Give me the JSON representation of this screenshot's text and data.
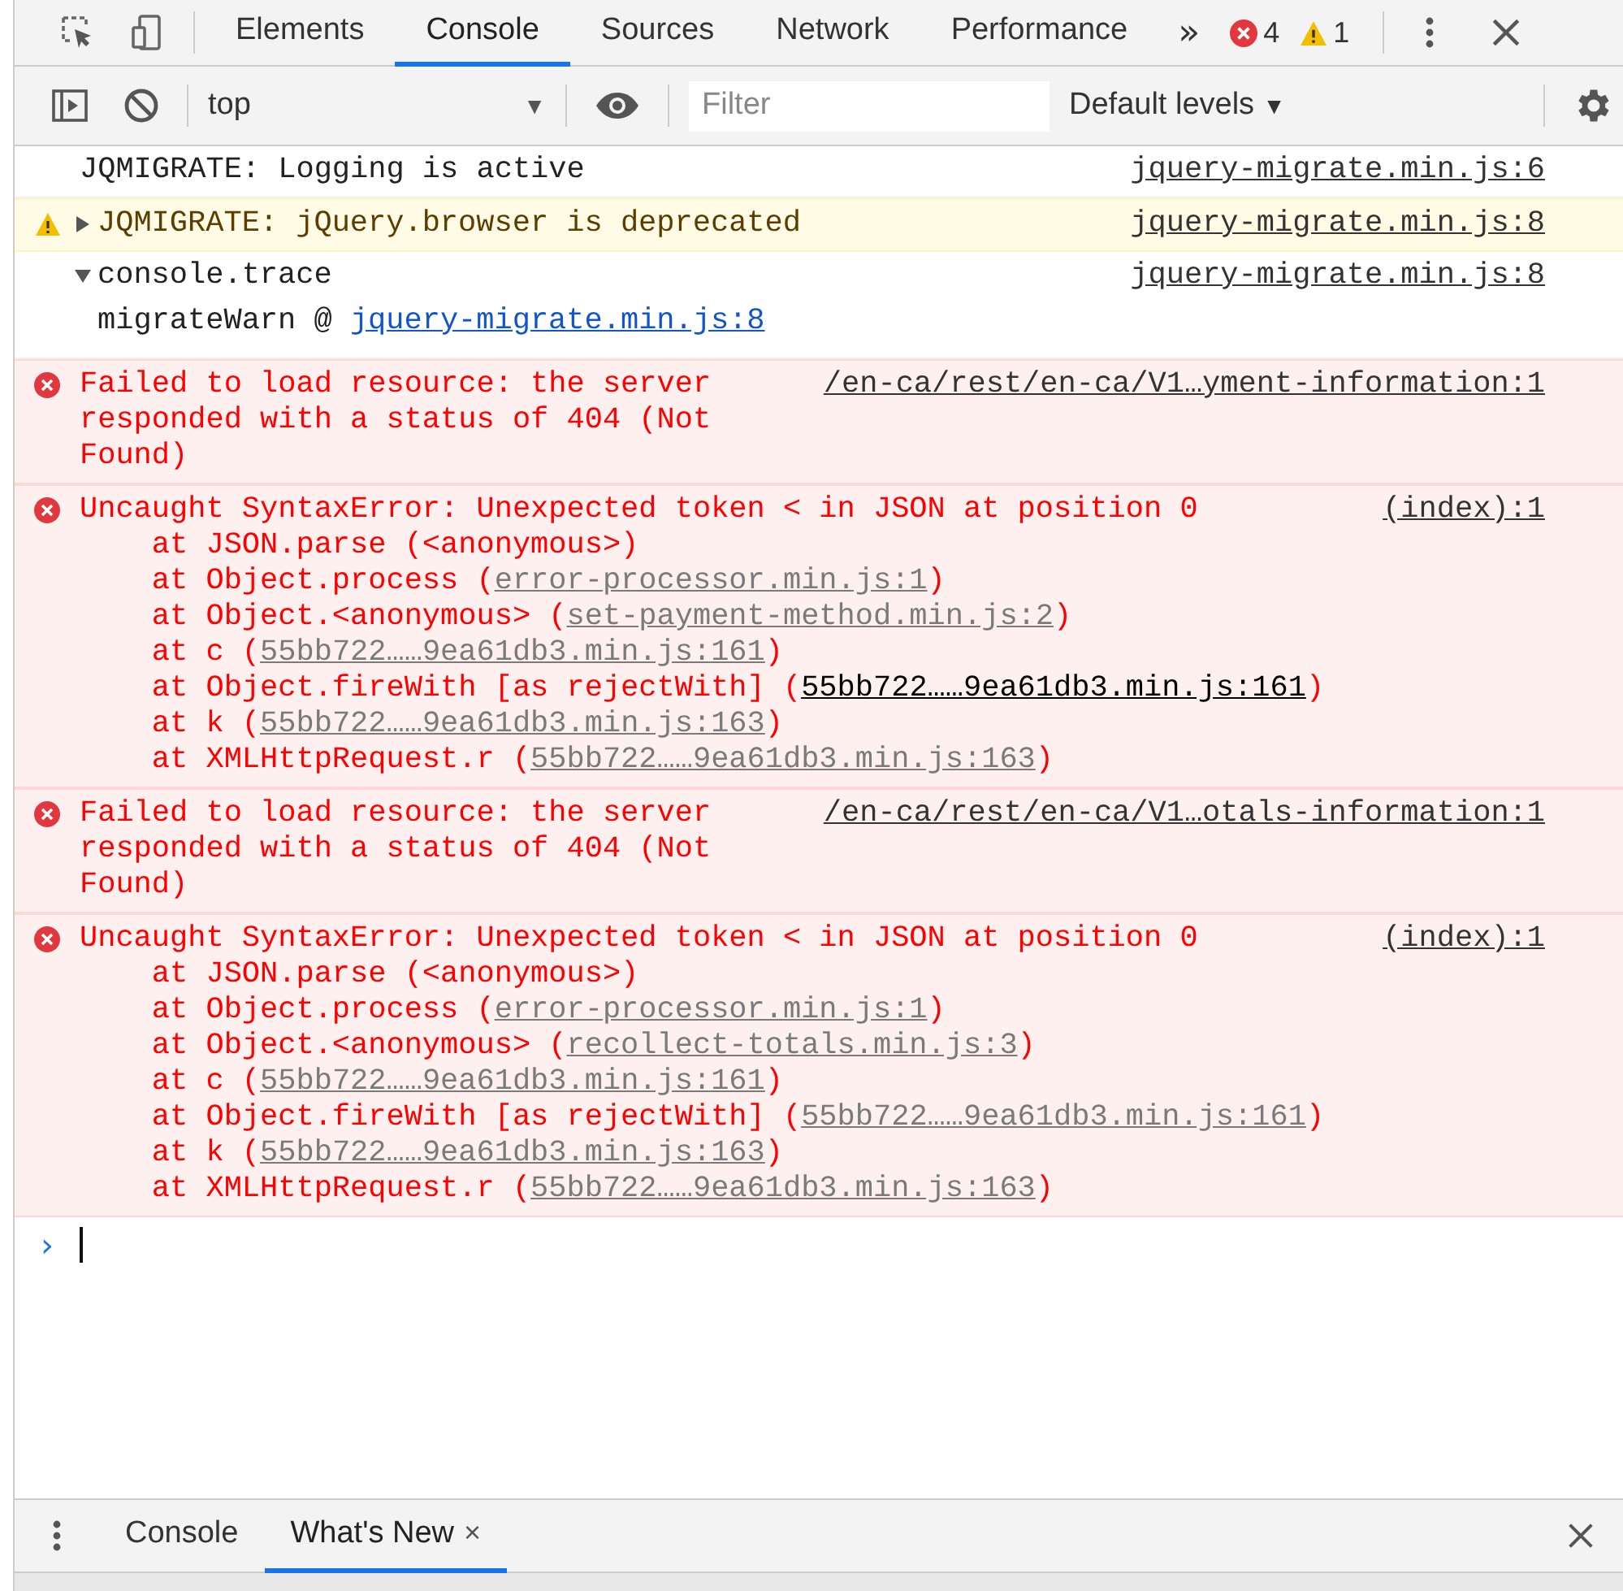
{
  "toolbar": {
    "tabs": [
      {
        "label": "Elements",
        "selected": false
      },
      {
        "label": "Console",
        "selected": true
      },
      {
        "label": "Sources",
        "selected": false
      },
      {
        "label": "Network",
        "selected": false
      },
      {
        "label": "Performance",
        "selected": false
      }
    ],
    "more_tabs": "»",
    "error_count": "4",
    "warning_count": "1"
  },
  "console_toolbar": {
    "context": "top",
    "context_caret": "▼",
    "filter": {
      "placeholder": "Filter"
    },
    "levels": "Default levels",
    "levels_caret": "▼"
  },
  "messages": [
    {
      "kind": "log",
      "text": "JQMIGRATE: Logging is active",
      "source": "jquery-migrate.min.js:6"
    },
    {
      "kind": "warning",
      "expanded": false,
      "text": "JQMIGRATE: jQuery.browser is deprecated",
      "source": "jquery-migrate.min.js:8"
    },
    {
      "kind": "trace",
      "expanded": true,
      "text": "console.trace",
      "source": "jquery-migrate.min.js:8",
      "frames": [
        {
          "text": "migrateWarn @ ",
          "link": "jquery-migrate.min.js:8"
        }
      ]
    },
    {
      "kind": "network",
      "text": "Failed to load resource: the server responded with a status of 404 (Not Found)",
      "source": "/en-ca/rest/en-ca/V1…yment-information:1"
    },
    {
      "kind": "error",
      "text": "Uncaught SyntaxError: Unexpected token < in JSON at position 0",
      "source": "(index):1",
      "frames": [
        {
          "text": "at JSON.parse (<anonymous>)"
        },
        {
          "text": "at Object.process (",
          "link": "error-processor.min.js:1",
          "after": ")",
          "hovered": false
        },
        {
          "text": "at Object.<anonymous> (",
          "link": "set-payment-method.min.js:2",
          "after": ")",
          "hovered": false
        },
        {
          "text": "at c (",
          "link": "55bb722……9ea61db3.min.js:161",
          "after": ")",
          "hovered": false
        },
        {
          "text": "at Object.fireWith [as rejectWith] (",
          "link": "55bb722……9ea61db3.min.js:161",
          "after": ")",
          "hovered": true
        },
        {
          "text": "at k (",
          "link": "55bb722……9ea61db3.min.js:163",
          "after": ")",
          "hovered": false
        },
        {
          "text": "at XMLHttpRequest.r (",
          "link": "55bb722……9ea61db3.min.js:163",
          "after": ")",
          "hovered": false
        }
      ]
    },
    {
      "kind": "network",
      "text": "Failed to load resource: the server responded with a status of 404 (Not Found)",
      "source": "/en-ca/rest/en-ca/V1…otals-information:1"
    },
    {
      "kind": "error",
      "text": "Uncaught SyntaxError: Unexpected token < in JSON at position 0",
      "source": "(index):1",
      "frames": [
        {
          "text": "at JSON.parse (<anonymous>)"
        },
        {
          "text": "at Object.process (",
          "link": "error-processor.min.js:1",
          "after": ")",
          "hovered": false
        },
        {
          "text": "at Object.<anonymous> (",
          "link": "recollect-totals.min.js:3",
          "after": ")",
          "hovered": false
        },
        {
          "text": "at c (",
          "link": "55bb722……9ea61db3.min.js:161",
          "after": ")",
          "hovered": false
        },
        {
          "text": "at Object.fireWith [as rejectWith] (",
          "link": "55bb722……9ea61db3.min.js:161",
          "after": ")",
          "hovered": false
        },
        {
          "text": "at k (",
          "link": "55bb722……9ea61db3.min.js:163",
          "after": ")",
          "hovered": false
        },
        {
          "text": "at XMLHttpRequest.r (",
          "link": "55bb722……9ea61db3.min.js:163",
          "after": ")",
          "hovered": false
        }
      ]
    }
  ],
  "prompt": {
    "symbol": "›"
  },
  "drawer": {
    "tabs": [
      {
        "label": "Console",
        "selected": false
      },
      {
        "label": "What's New",
        "selected": true,
        "close": "×"
      }
    ]
  }
}
